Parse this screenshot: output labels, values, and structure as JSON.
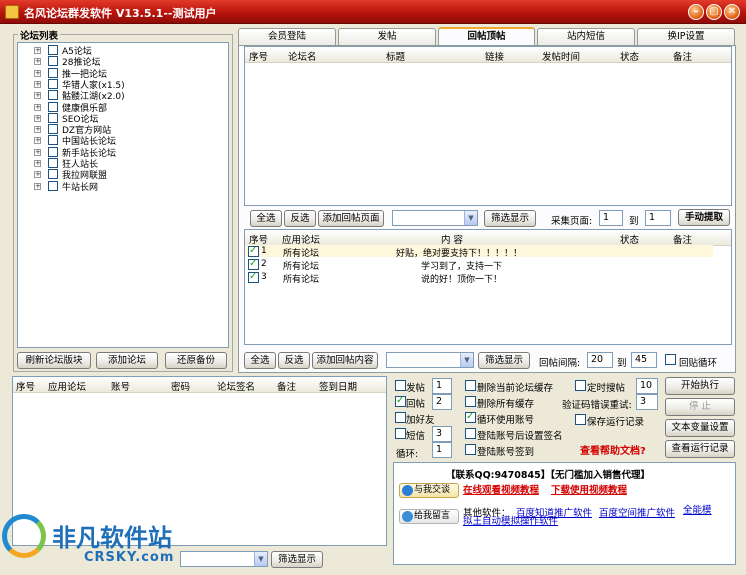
{
  "window": {
    "title": "名风论坛群发软件 V13.5.1--测试用户",
    "minimize": "–",
    "restore": "▢",
    "close": "✕"
  },
  "forum_list": {
    "title": "论坛列表",
    "items": [
      "A5论坛",
      "28推论坛",
      "推一把论坛",
      "华错人家(x1.5)",
      "骷髅江湖(x2.0)",
      "健康俱乐部",
      "SEO论坛",
      "DZ官方网站",
      "中国站长论坛",
      "新手站长论坛",
      "狂人站长",
      "我拉网联盟",
      "牛站长网"
    ],
    "btn_refresh": "刷新论坛版块",
    "btn_add": "添加论坛",
    "btn_restore": "还原备份"
  },
  "tabs": [
    "会员登陆",
    "发帖",
    "回帖顶帖",
    "站内短信",
    "换IP设置"
  ],
  "active_tab": 2,
  "top_table": {
    "headers": [
      "序号",
      "论坛名",
      "标题",
      "链接",
      "发帖时间",
      "状态",
      "备注"
    ]
  },
  "toolbar1": {
    "select_all": "全选",
    "invert": "反选",
    "add_reply_page": "添加回帖页面",
    "filter": "筛选显示",
    "collect_pages_label": "采集页面:",
    "page_from": "1",
    "to_label": "到",
    "page_to": "1",
    "manual_fetch": "手动提取"
  },
  "mid_table": {
    "headers": [
      "序号",
      "应用论坛",
      "内    容",
      "状态",
      "备注"
    ],
    "rows": [
      {
        "no": "1",
        "forum": "所有论坛",
        "content": "好贴，绝对要支持下！！！！！"
      },
      {
        "no": "2",
        "forum": "所有论坛",
        "content": "学习到了，支持一下"
      },
      {
        "no": "3",
        "forum": "所有论坛",
        "content": "说的好！顶你一下！"
      }
    ]
  },
  "toolbar2": {
    "select_all": "全选",
    "invert": "反选",
    "add_reply_content": "添加回帖内容",
    "filter": "筛选显示",
    "interval_label": "回帖间隔:",
    "interval_from": "20",
    "to_label": "到",
    "interval_to": "45",
    "loop_reply": "回贴循环"
  },
  "account_table": {
    "headers": [
      "序号",
      "应用论坛",
      "账号",
      "密码",
      "论坛签名",
      "备注",
      "签到日期"
    ],
    "filter": "筛选显示"
  },
  "options": {
    "post": {
      "label": "发帖",
      "value": "1"
    },
    "reply": {
      "label": "回帖",
      "value": "2"
    },
    "add_friend": {
      "label": "加好友"
    },
    "sms": {
      "label": "短信",
      "value": "3"
    },
    "loop_label": "循环:",
    "loop_value": "1",
    "del_current_cache": "删除当前论坛缓存",
    "timed_post": "定时搜帖",
    "timed_value": "10",
    "del_all_cache": "删除所有缓存",
    "captcha_retry_label": "验证码错误重试:",
    "captcha_retry_value": "3",
    "loop_account": "循环使用账号",
    "save_log": "保存运行记录",
    "set_signature": "登陆账号后设置签名",
    "checkin": "登陆账号签到",
    "help": "查看帮助文档?"
  },
  "actions": {
    "start": "开始执行",
    "stop": "停 止",
    "text_vars": "文本变量设置",
    "view_log": "查看运行记录"
  },
  "info": {
    "contact": "【联系QQ:9470845】【无门槛加入销售代理】",
    "chat": "与我交谈",
    "video1": "在线观看视频教程",
    "video2": "下载使用视频教程",
    "leave_msg": "给我留言",
    "other_label": "其他软件：",
    "soft1": "百度知道推广软件",
    "soft2": "百度空间推广软件",
    "soft3": "全能模拟王自动模拟操作软件"
  },
  "watermark": {
    "brand_cn": "非凡软件站",
    "brand_en": "CRSKY.com"
  }
}
